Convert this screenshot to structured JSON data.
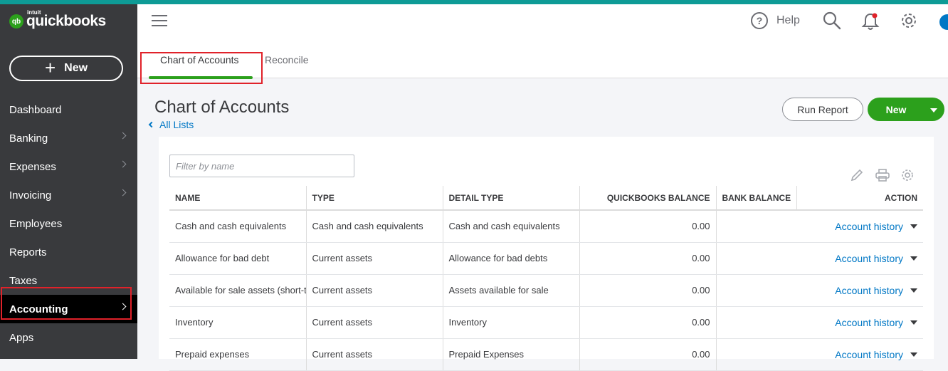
{
  "app": {
    "logo_brand": "quickbooks",
    "logo_maker": "intuit",
    "logo_badge": "qb"
  },
  "sidebar": {
    "new_label": "New",
    "items": [
      {
        "label": "Dashboard"
      },
      {
        "label": "Banking"
      },
      {
        "label": "Expenses"
      },
      {
        "label": "Invoicing"
      },
      {
        "label": "Employees"
      },
      {
        "label": "Reports"
      },
      {
        "label": "Taxes"
      },
      {
        "label": "Accounting"
      },
      {
        "label": "Apps"
      }
    ]
  },
  "header": {
    "help_label": "Help",
    "tabs": [
      {
        "label": "Chart of Accounts"
      },
      {
        "label": "Reconcile"
      }
    ]
  },
  "main": {
    "title": "Chart of Accounts",
    "back_link": "All Lists",
    "run_report_label": "Run Report",
    "new_label": "New",
    "filter_placeholder": "Filter by name",
    "columns": [
      "NAME",
      "TYPE",
      "DETAIL TYPE",
      "QUICKBOOKS BALANCE",
      "BANK BALANCE",
      "ACTION"
    ],
    "rows": [
      {
        "name": "Cash and cash equivalents",
        "type": "Cash and cash equivalents",
        "detail": "Cash and cash equivalents",
        "qb_balance": "0.00",
        "bank_balance": "",
        "action": "Account history"
      },
      {
        "name": "Allowance for bad debt",
        "type": "Current assets",
        "detail": "Allowance for bad debts",
        "qb_balance": "0.00",
        "bank_balance": "",
        "action": "Account history"
      },
      {
        "name": "Available for sale assets (short-t",
        "type": "Current assets",
        "detail": "Assets available for sale",
        "qb_balance": "0.00",
        "bank_balance": "",
        "action": "Account history"
      },
      {
        "name": "Inventory",
        "type": "Current assets",
        "detail": "Inventory",
        "qb_balance": "0.00",
        "bank_balance": "",
        "action": "Account history"
      },
      {
        "name": "Prepaid expenses",
        "type": "Current assets",
        "detail": "Prepaid Expenses",
        "qb_balance": "0.00",
        "bank_balance": "",
        "action": "Account history"
      }
    ]
  },
  "colors": {
    "sidebar_bg": "#393a3d",
    "accent_green": "#2ca01c",
    "link_blue": "#0077c5",
    "highlight_red": "#e0222a",
    "top_stripe": "#0e9b96"
  }
}
